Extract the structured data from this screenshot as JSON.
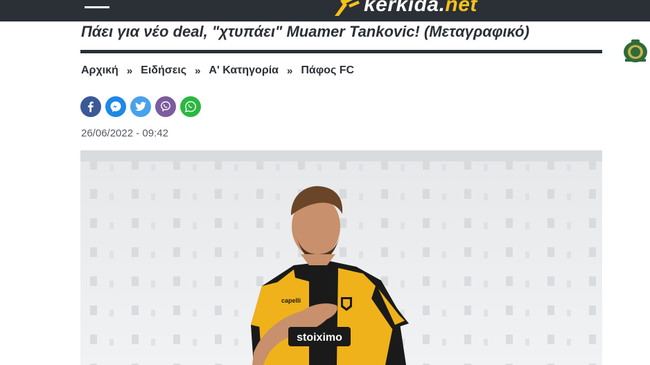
{
  "header": {
    "logo_text": "kerkida",
    "logo_tld": "net",
    "logo_dot": "."
  },
  "article": {
    "title": "Πάει για νέο deal, \"χτυπάει\" Muamer Tankovic! (Μεταγραφικό)",
    "date": "26/06/2022 - 09:42"
  },
  "breadcrumb": [
    {
      "label": "Αρχική"
    },
    {
      "label": "Ειδήσεις"
    },
    {
      "label": "Α' Κατηγορία"
    },
    {
      "label": "Πάφος FC"
    }
  ],
  "breadcrumb_separator": "»",
  "share": [
    {
      "icon": "facebook-icon",
      "color": "#3b5998"
    },
    {
      "icon": "messenger-icon",
      "color": "#1e88e5"
    },
    {
      "icon": "twitter-icon",
      "color": "#4aa1eb"
    },
    {
      "icon": "viber-icon",
      "color": "#7b5c9e"
    },
    {
      "icon": "whatsapp-icon",
      "color": "#2bb741"
    }
  ],
  "hero_image": {
    "jersey_sponsor": "stoiximo",
    "jersey_brand": "capelli"
  },
  "colors": {
    "header_bg": "#2b2f36",
    "accent": "#f5c21b",
    "text": "#2b2f36",
    "date_text": "#555a61"
  }
}
